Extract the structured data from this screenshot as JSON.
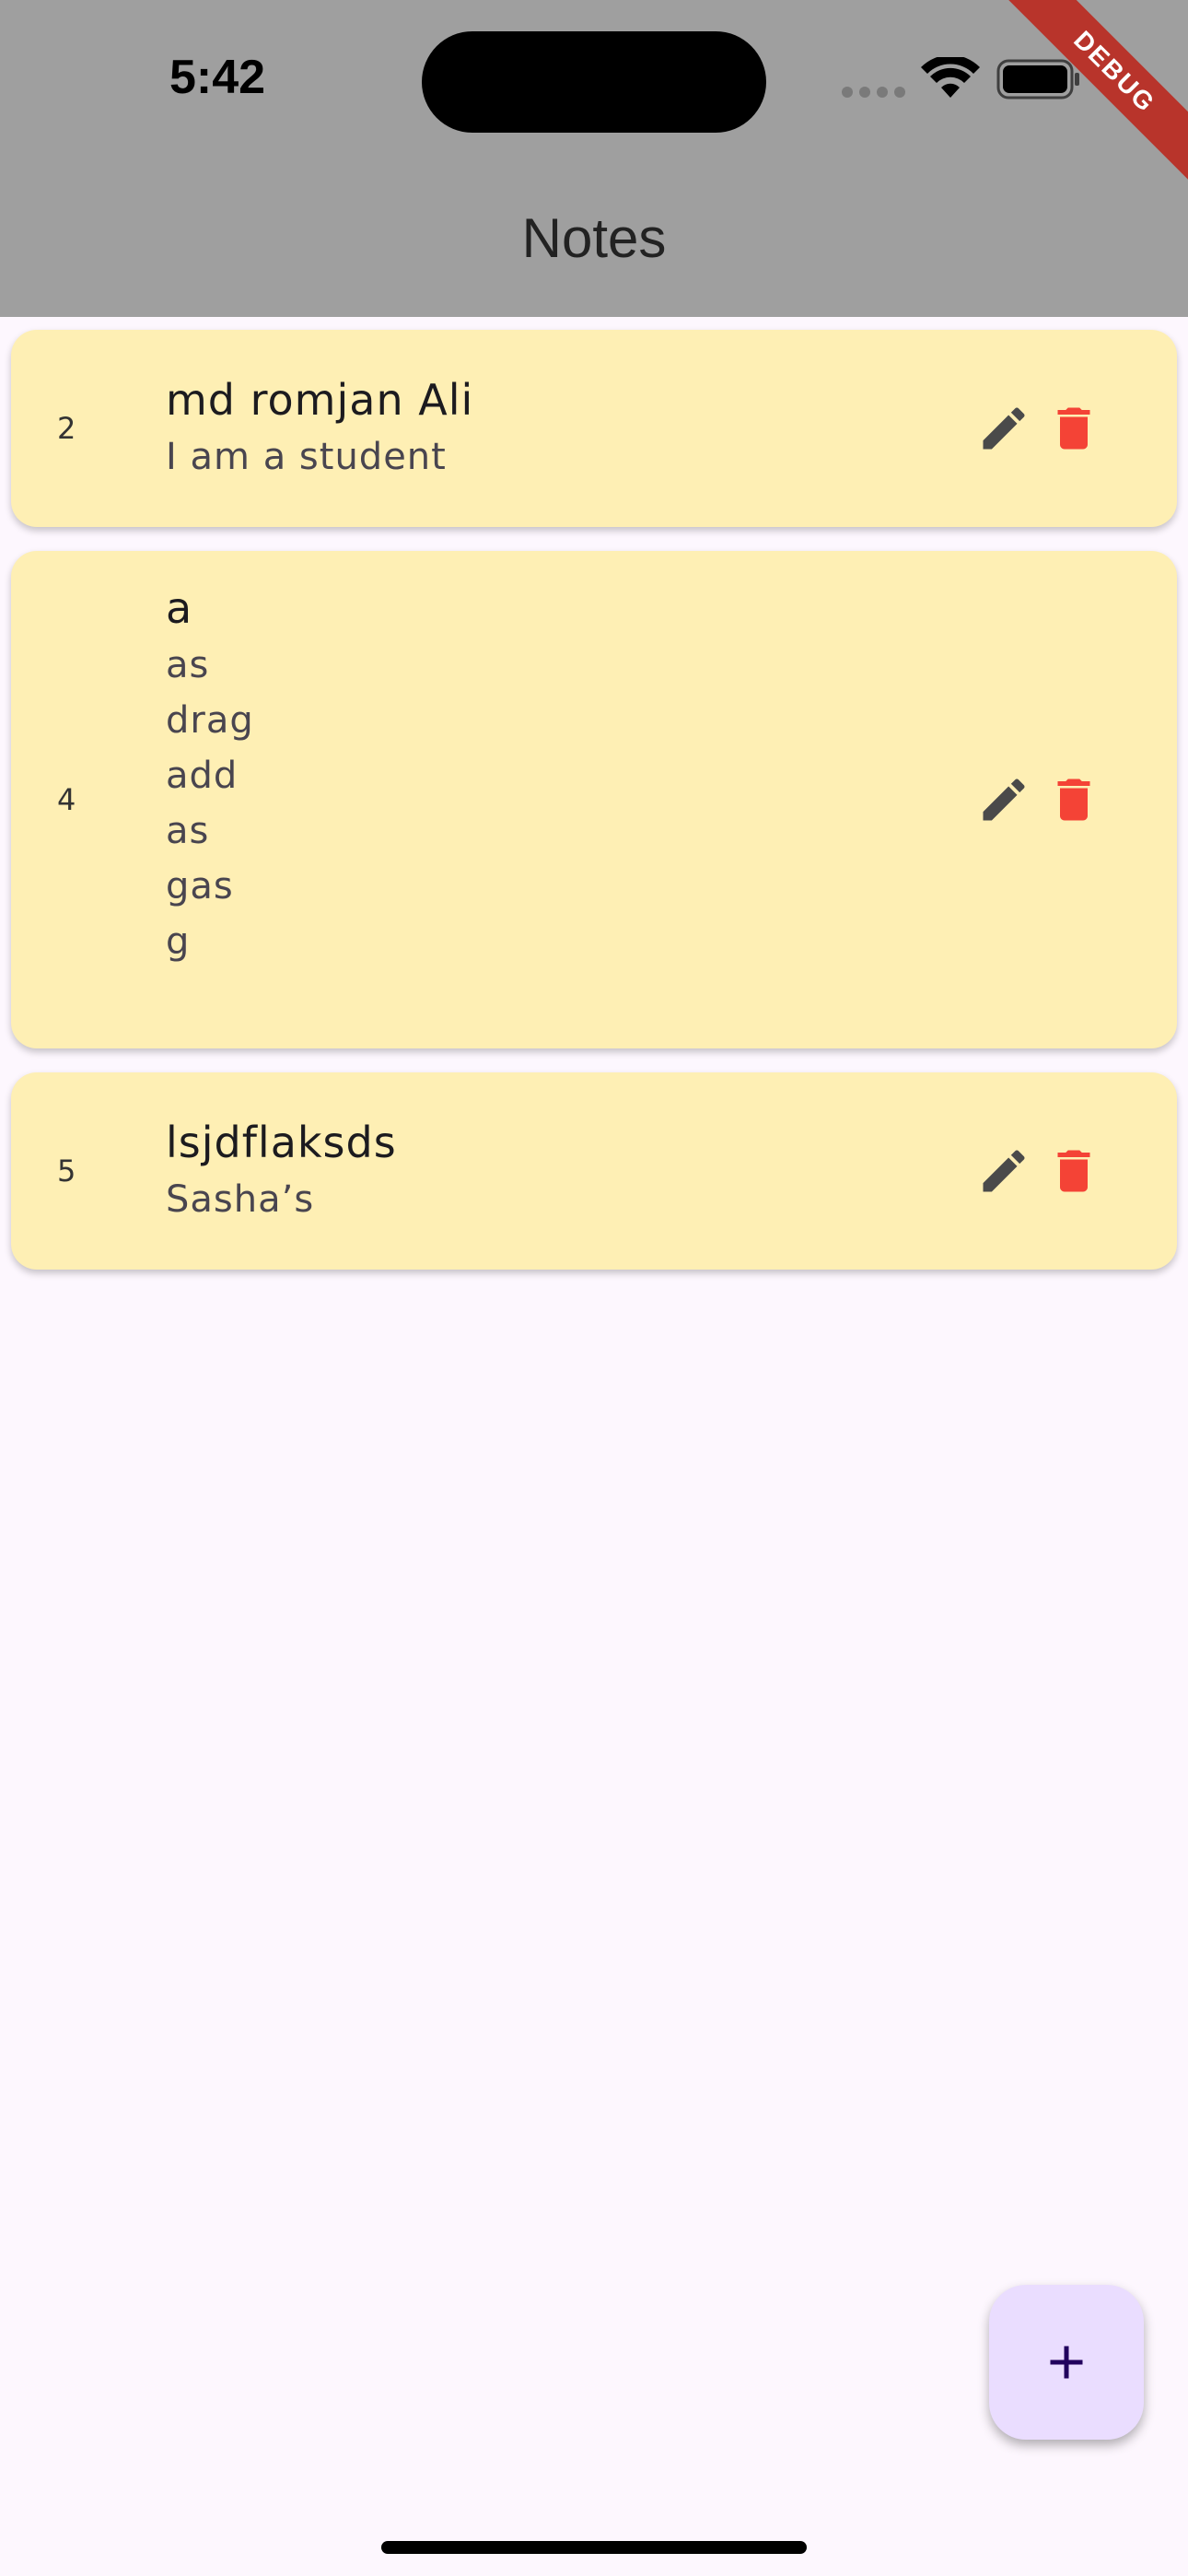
{
  "status_bar": {
    "time": "5:42",
    "debug_label": "DEBUG"
  },
  "app_bar": {
    "title": "Notes"
  },
  "colors": {
    "app_bar_bg": "#9f9f9f",
    "page_bg": "#fdf7fe",
    "card_bg": "#feefb4",
    "edit_icon": "#4a4a4a",
    "delete_icon": "#f44336",
    "fab_bg": "#eaddff",
    "debug_banner": "#b8342b"
  },
  "notes": [
    {
      "id": "2",
      "title": "md romjan Ali",
      "body": "I am a student",
      "edit_icon": "edit-icon",
      "delete_icon": "delete-icon"
    },
    {
      "id": "4",
      "title": "a",
      "body": "as\ndrag\nadd\nas\ngas\ng",
      "edit_icon": "edit-icon",
      "delete_icon": "delete-icon"
    },
    {
      "id": "5",
      "title": "lsjdflaksds",
      "body": "Sasha’s",
      "edit_icon": "edit-icon",
      "delete_icon": "delete-icon"
    }
  ],
  "fab": {
    "icon": "plus-icon"
  }
}
